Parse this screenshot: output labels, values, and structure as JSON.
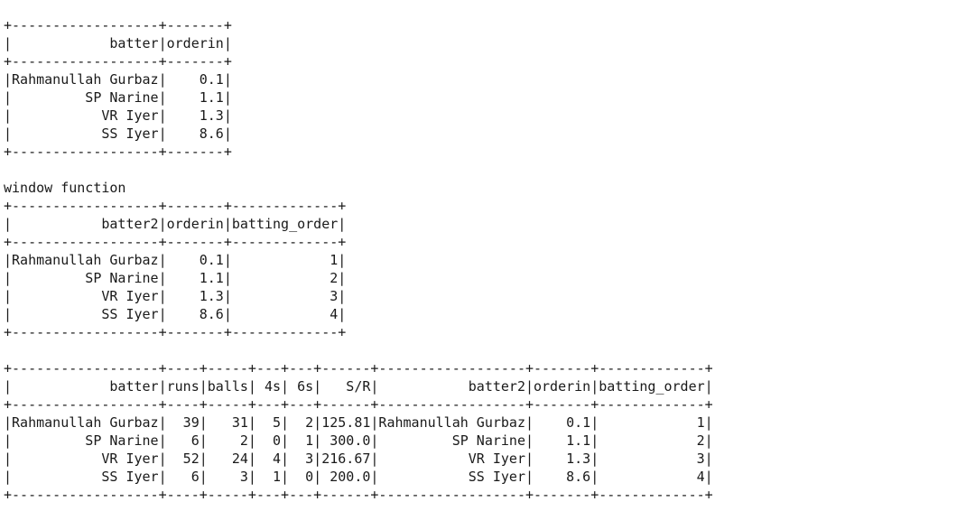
{
  "console": {
    "lines": [
      "+------------------+-------+",
      "|            batter|orderin|",
      "+------------------+-------+",
      "|Rahmanullah Gurbaz|    0.1|",
      "|         SP Narine|    1.1|",
      "|           VR Iyer|    1.3|",
      "|           SS Iyer|    8.6|",
      "+------------------+-------+",
      "",
      "window function",
      "+------------------+-------+-------------+",
      "|           batter2|orderin|batting_order|",
      "+------------------+-------+-------------+",
      "|Rahmanullah Gurbaz|    0.1|            1|",
      "|         SP Narine|    1.1|            2|",
      "|           VR Iyer|    1.3|            3|",
      "|           SS Iyer|    8.6|            4|",
      "+------------------+-------+-------------+",
      "",
      "+------------------+----+-----+---+---+------+------------------+-------+-------------+",
      "|            batter|runs|balls| 4s| 6s|   S/R|           batter2|orderin|batting_order|",
      "+------------------+----+-----+---+---+------+------------------+-------+-------------+",
      "|Rahmanullah Gurbaz|  39|   31|  5|  2|125.81|Rahmanullah Gurbaz|    0.1|            1|",
      "|         SP Narine|   6|    2|  0|  1| 300.0|         SP Narine|    1.1|            2|",
      "|           VR Iyer|  52|   24|  4|  3|216.67|           VR Iyer|    1.3|            3|",
      "|           SS Iyer|   6|    3|  1|  0| 200.0|           SS Iyer|    8.6|            4|",
      "+------------------+----+-----+---+---+------+------------------+-------+-------------+"
    ]
  }
}
